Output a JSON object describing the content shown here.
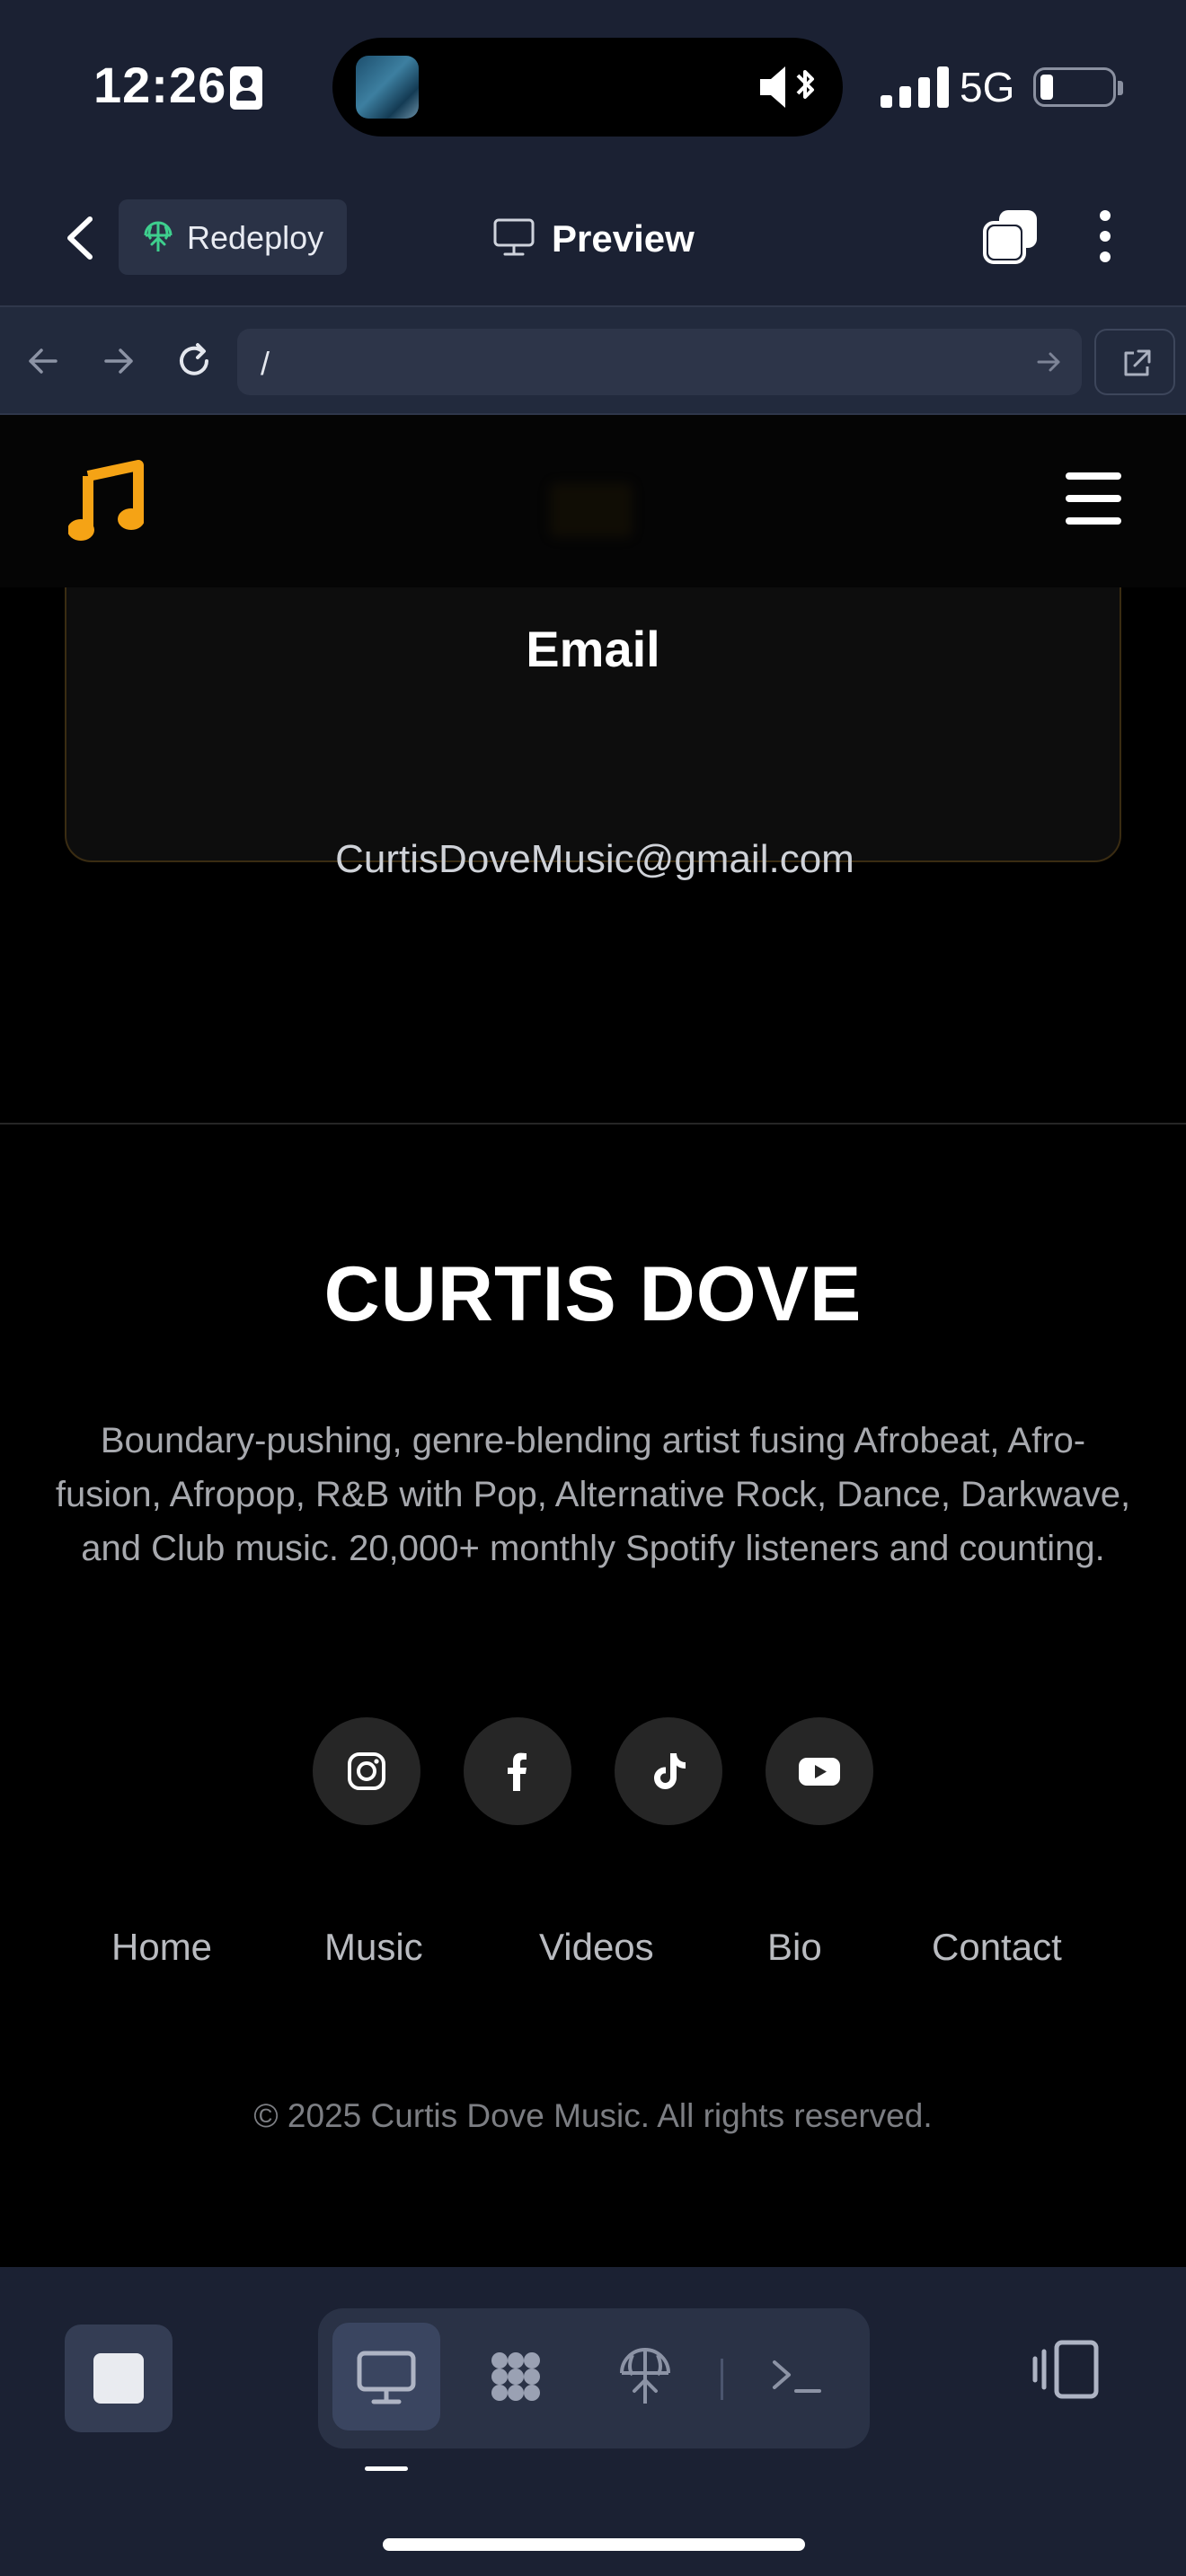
{
  "status_bar": {
    "time": "12:26",
    "network": "5G"
  },
  "app_header": {
    "redeploy_label": "Redeploy",
    "title": "Preview"
  },
  "browser": {
    "url": "/"
  },
  "site": {
    "email_card": {
      "title": "Email",
      "value": "CurtisDoveMusic@gmail.com"
    },
    "footer": {
      "brand": "CURTIS DOVE",
      "description": "Boundary-pushing, genre-blending artist fusing Afrobeat, Afro-fusion, Afropop, R&B with Pop, Alternative Rock, Dance, Darkwave, and Club music. 20,000+ monthly Spotify listeners and counting.",
      "socials": [
        "instagram-icon",
        "facebook-icon",
        "tiktok-icon",
        "youtube-icon"
      ],
      "links": [
        "Home",
        "Music",
        "Videos",
        "Bio",
        "Contact"
      ],
      "copyright": "© 2025 Curtis Dove Music. All rights reserved."
    }
  },
  "colors": {
    "app_chrome": "#1b2133",
    "site_background": "#000000",
    "accent_gold": "#f5a315",
    "redeploy_green": "#3ecf8e"
  },
  "icons": {
    "logo": "music-note-icon",
    "menu": "hamburger-icon",
    "bottom_modes": [
      "desktop-icon",
      "grid-icon",
      "deploy-icon",
      "terminal-icon"
    ]
  }
}
